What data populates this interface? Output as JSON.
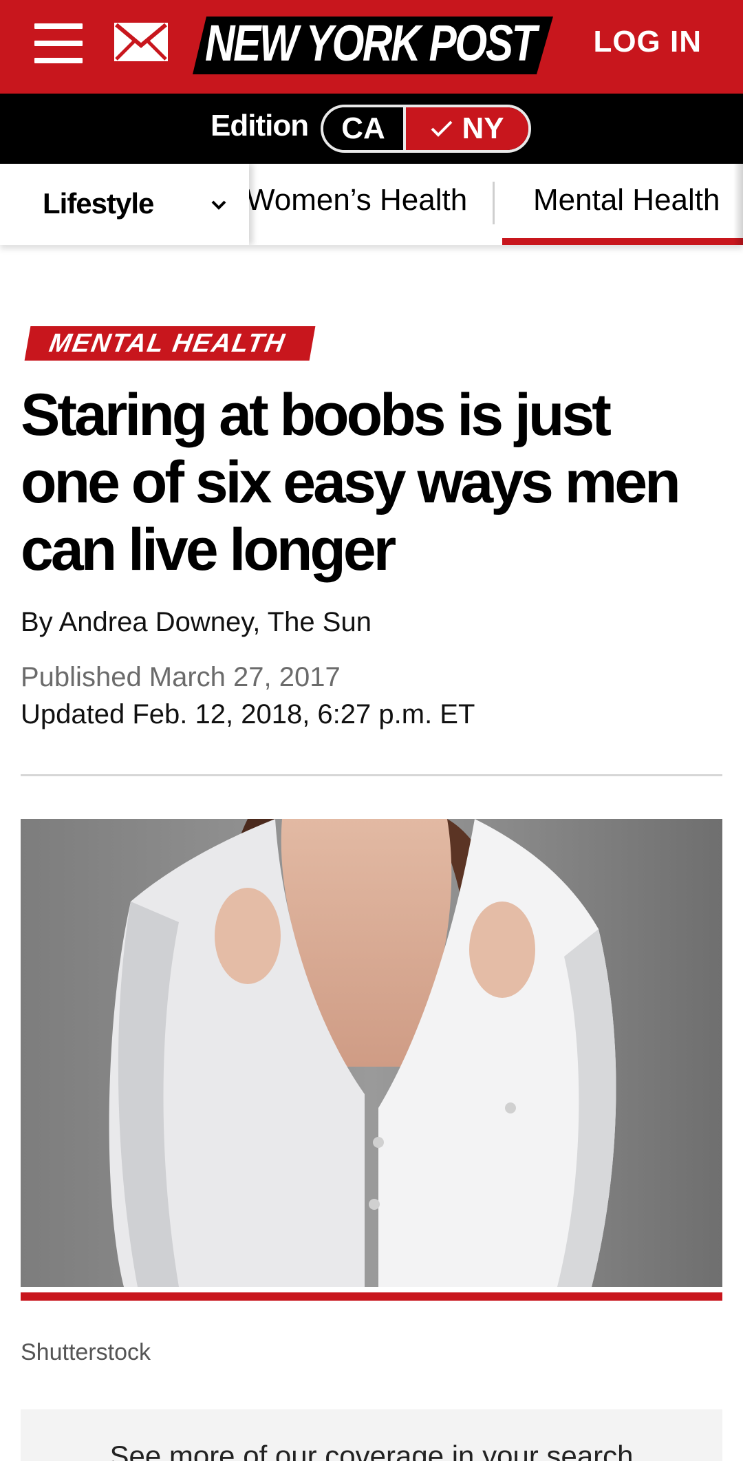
{
  "header": {
    "brand": "NEW YORK POST",
    "login_label": "LOG IN",
    "menu_icon": "hamburger-icon",
    "mail_icon": "mail-icon",
    "accent_color": "#c8161d"
  },
  "edition": {
    "label": "Edition",
    "options": [
      "CA",
      "NY"
    ],
    "selected": "NY"
  },
  "section_nav": {
    "current_section": "Lifestyle",
    "tabs": [
      {
        "label": "Women’s Health",
        "active": false
      },
      {
        "label": "Mental Health",
        "active": true
      }
    ]
  },
  "article": {
    "kicker": "MENTAL HEALTH",
    "headline_lines": [
      "Staring at boobs is just",
      "one of six easy ways men",
      "can live longer"
    ],
    "byline_prefix": "By",
    "author": "Andrea Downey, The Sun",
    "published": "Published March 27, 2017",
    "updated": "Updated Feb. 12, 2018, 6:27 p.m. ET",
    "image_credit": "Shutterstock"
  },
  "more": {
    "text": "See more of our coverage in your search"
  }
}
